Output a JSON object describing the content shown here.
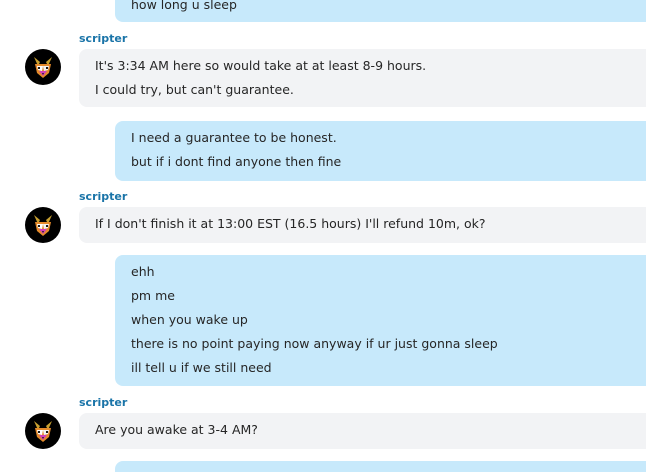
{
  "messages": [
    {
      "type": "outgoing",
      "lines": [
        "how long u sleep"
      ]
    },
    {
      "type": "incoming",
      "sender": "scripter",
      "lines": [
        "It's 3:34 AM here so would take at at least 8-9 hours.",
        "I could try, but can't guarantee."
      ]
    },
    {
      "type": "outgoing",
      "lines": [
        "I need a guarantee to be honest.",
        "but if i dont find anyone then fine"
      ]
    },
    {
      "type": "incoming",
      "sender": "scripter",
      "lines": [
        "If I don't finish it at 13:00 EST (16.5 hours) I'll refund 10m, ok?"
      ]
    },
    {
      "type": "outgoing",
      "lines": [
        "ehh",
        "pm me",
        "when you wake up",
        "there is no point paying now anyway if ur just gonna sleep",
        "ill tell u if we still need"
      ]
    },
    {
      "type": "incoming",
      "sender": "scripter",
      "lines": [
        "Are you awake at 3-4 AM?"
      ]
    },
    {
      "type": "outgoing",
      "lines": []
    }
  ],
  "colors": {
    "outgoing_bubble": "#c7e9fb",
    "incoming_bubble": "#f2f3f5",
    "sender_name": "#1a74a8",
    "text": "#262626"
  },
  "icons": {
    "avatar": "fox-face-avatar"
  }
}
